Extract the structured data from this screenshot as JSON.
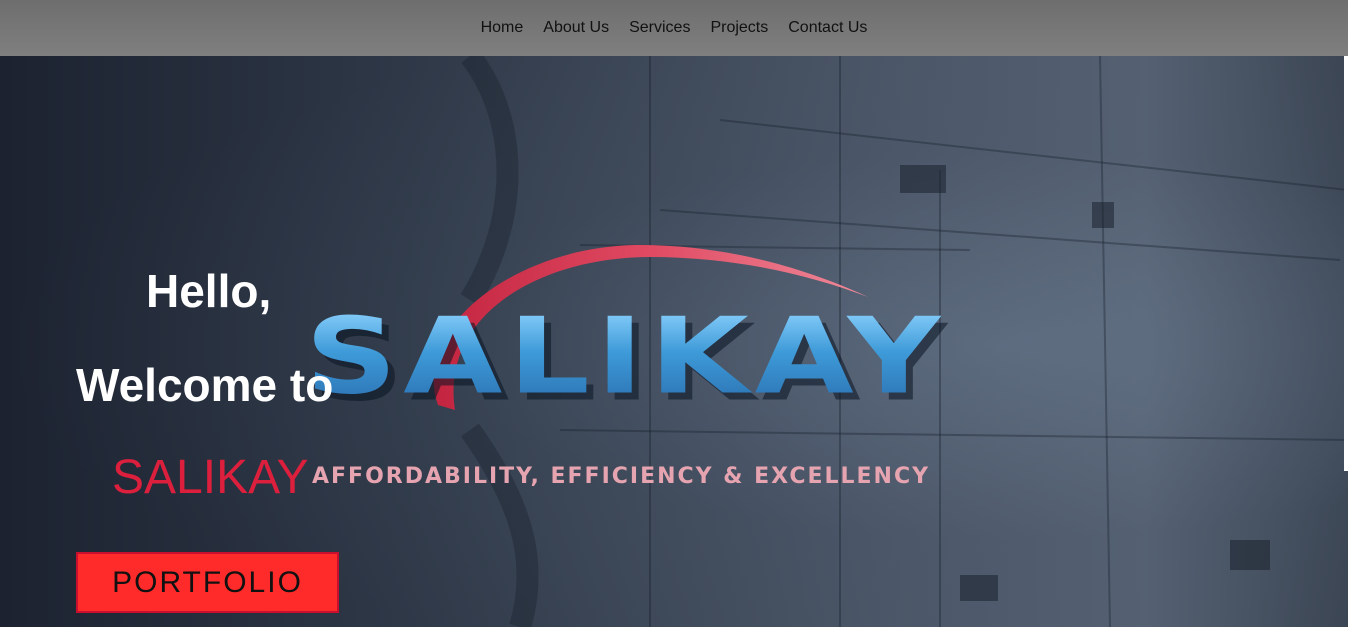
{
  "nav": {
    "items": [
      {
        "label": "Home"
      },
      {
        "label": "About Us"
      },
      {
        "label": "Services"
      },
      {
        "label": "Projects"
      },
      {
        "label": "Contact Us"
      }
    ]
  },
  "hero": {
    "greeting": "Hello,",
    "welcome": "Welcome to",
    "brand_name": "SALIKAY",
    "cta_label": "PORTFOLIO"
  },
  "logo": {
    "wordmark": "SALIKAY",
    "tagline": "AFFORDABILITY, EFFICIENCY & EXCELLENCY"
  },
  "colors": {
    "brand_red": "#dc1f3c",
    "button_red": "#ff2a2a",
    "logo_blue": "#4aa3e0",
    "nav_bg": "#777777"
  }
}
